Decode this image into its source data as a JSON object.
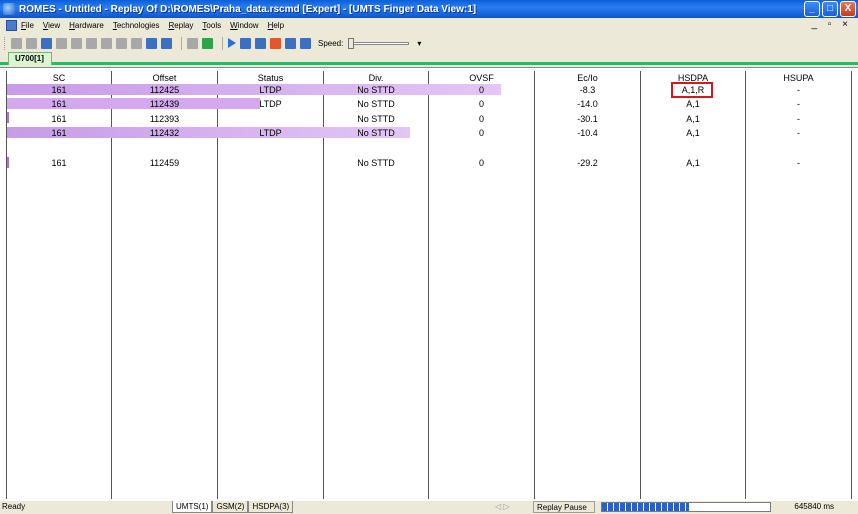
{
  "window": {
    "title": "ROMES - Untitled - Replay Of D:\\ROMES\\Praha_data.rscmd [Expert] - [UMTS Finger Data View:1]",
    "buttons": {
      "minimize": "_",
      "maximize": "□",
      "close": "X"
    }
  },
  "menu": {
    "items": [
      "File",
      "View",
      "Hardware",
      "Technologies",
      "Replay",
      "Tools",
      "Window",
      "Help"
    ],
    "mdi_controls": "_ ▫ ×"
  },
  "toolbar": {
    "speed_label": "Speed:",
    "dropdown_arrow": "▾"
  },
  "view_tab": {
    "label": "U700[1]"
  },
  "table": {
    "columns": [
      "SC",
      "Offset",
      "Status",
      "Div.",
      "OVSF",
      "Ec/Io",
      "HSDPA",
      "HSUPA"
    ],
    "rows": [
      {
        "sc": "161",
        "offset": "112425",
        "status": "LTDP",
        "div": "No STTD",
        "ovsf": "0",
        "ecio": "-8.3",
        "hsdpa": "A,1,R",
        "hsupa": "-"
      },
      {
        "sc": "161",
        "offset": "112439",
        "status": "LTDP",
        "div": "No STTD",
        "ovsf": "0",
        "ecio": "-14.0",
        "hsdpa": "A,1",
        "hsupa": "-"
      },
      {
        "sc": "161",
        "offset": "112393",
        "status": "",
        "div": "No STTD",
        "ovsf": "0",
        "ecio": "-30.1",
        "hsdpa": "A,1",
        "hsupa": "-"
      },
      {
        "sc": "161",
        "offset": "112432",
        "status": "LTDP",
        "div": "No STTD",
        "ovsf": "0",
        "ecio": "-10.4",
        "hsdpa": "A,1",
        "hsupa": "-"
      },
      {
        "sc": "161",
        "offset": "112459",
        "status": "",
        "div": "No STTD",
        "ovsf": "0",
        "ecio": "-29.2",
        "hsdpa": "A,1",
        "hsupa": "-"
      }
    ],
    "bar_color": "#d3a8ef",
    "highlight_color": "#d21a1a"
  },
  "statusbar": {
    "ready": "Ready",
    "tabs": [
      "UMTS(1)",
      "GSM(2)",
      "HSDPA(3)"
    ],
    "nav": "◁ ▷",
    "replay_state": "Replay Pause",
    "progress": 0.52,
    "time": "645840 ms"
  }
}
